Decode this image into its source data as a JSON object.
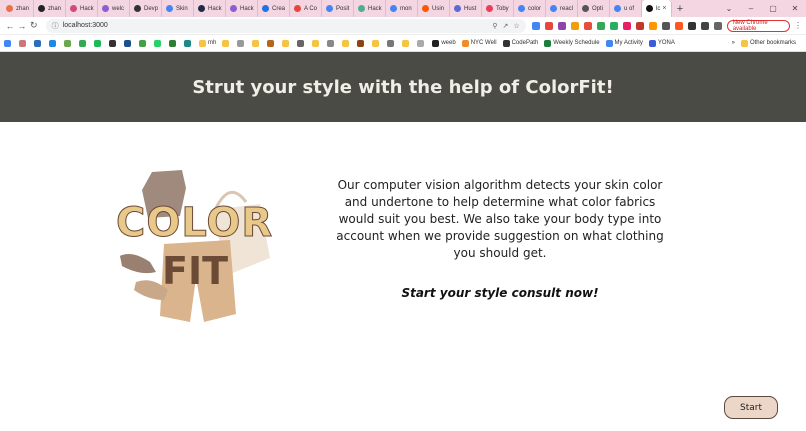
{
  "browser": {
    "tabs": [
      {
        "label": "zhan",
        "color": "#e8734a"
      },
      {
        "label": "zhan",
        "color": "#222222"
      },
      {
        "label": "Hack",
        "color": "#d14a7a"
      },
      {
        "label": "welc",
        "color": "#8e5bd6"
      },
      {
        "label": "Devp",
        "color": "#333333"
      },
      {
        "label": "Skin",
        "color": "#4285f4"
      },
      {
        "label": "Hack",
        "color": "#1f2a44"
      },
      {
        "label": "Hack",
        "color": "#8e5bd6"
      },
      {
        "label": "Crea",
        "color": "#1a73e8"
      },
      {
        "label": "A Co",
        "color": "#e8453c"
      },
      {
        "label": "Posit",
        "color": "#4285f4"
      },
      {
        "label": "Hack",
        "color": "#4caf8a"
      },
      {
        "label": "mon",
        "color": "#4285f4"
      },
      {
        "label": "Usin",
        "color": "#ff5700"
      },
      {
        "label": "Hust",
        "color": "#5b6bd6"
      },
      {
        "label": "Toby",
        "color": "#e83e5a"
      },
      {
        "label": "color",
        "color": "#4285f4"
      },
      {
        "label": "reacl",
        "color": "#4285f4"
      },
      {
        "label": "Opti",
        "color": "#555555"
      },
      {
        "label": "u of",
        "color": "#4285f4"
      },
      {
        "label": "lc",
        "color": "#111111"
      }
    ],
    "new_tab": "+",
    "window_controls": [
      "⌄",
      "–",
      "▢",
      "✕"
    ],
    "url": "localhost:3000",
    "update_button": "New Chrome available",
    "bookmarks": [
      {
        "label": "",
        "color": "#4285f4"
      },
      {
        "label": "",
        "color": "#c77"
      },
      {
        "label": "",
        "color": "#2a6ebb"
      },
      {
        "label": "",
        "color": "#1e88e5"
      },
      {
        "label": "",
        "color": "#6aa84f"
      },
      {
        "label": "",
        "color": "#34a853"
      },
      {
        "label": "",
        "color": "#1db954"
      },
      {
        "label": "",
        "color": "#333"
      },
      {
        "label": "",
        "color": "#1f4e8c"
      },
      {
        "label": "",
        "color": "#43a047"
      },
      {
        "label": "",
        "color": "#25d366"
      },
      {
        "label": "",
        "color": "#2e7d32"
      },
      {
        "label": "",
        "color": "#1a8a8a"
      },
      {
        "label": "mh",
        "color": "#f6c342"
      },
      {
        "label": "",
        "color": "#f6c342"
      },
      {
        "label": "",
        "color": "#999"
      },
      {
        "label": "",
        "color": "#f6c342"
      },
      {
        "label": "",
        "color": "#b5651d"
      },
      {
        "label": "",
        "color": "#f6c342"
      },
      {
        "label": "",
        "color": "#666"
      },
      {
        "label": "",
        "color": "#f6c342"
      },
      {
        "label": "",
        "color": "#888"
      },
      {
        "label": "",
        "color": "#f6c342"
      },
      {
        "label": "",
        "color": "#8b4513"
      },
      {
        "label": "",
        "color": "#f6c342"
      },
      {
        "label": "",
        "color": "#777"
      },
      {
        "label": "",
        "color": "#f6c342"
      },
      {
        "label": "",
        "color": "#aaa"
      },
      {
        "label": "weeb",
        "color": "#222"
      },
      {
        "label": "NYC Well",
        "color": "#f28c28"
      },
      {
        "label": "CodePath",
        "color": "#333"
      },
      {
        "label": "Weekly Schedule",
        "color": "#188038"
      },
      {
        "label": "My Activity",
        "color": "#4285f4"
      },
      {
        "label": "YONA",
        "color": "#3b5bdb"
      }
    ],
    "bookmarks_more": "»",
    "other_bookmarks": "Other bookmarks"
  },
  "page": {
    "banner_title": "Strut your style with the help of ColorFit!",
    "logo_word_1": "COLOR",
    "logo_word_2": "FIT",
    "description": "Our computer vision algorithm detects your skin color and undertone to help determine what color fabrics would suit you best. We also take your body type into account when we provide suggestion on what clothing you should get.",
    "cta": "Start your style consult now!",
    "start_button": "Start"
  },
  "colors": {
    "banner_bg": "#4a4b45",
    "banner_text": "#f0eee6",
    "button_bg": "#ecd6c8",
    "button_border": "#5a4a40",
    "logo_gold": "#e9c98a",
    "logo_brown": "#6b4a36",
    "logo_tan": "#d9b48c"
  }
}
